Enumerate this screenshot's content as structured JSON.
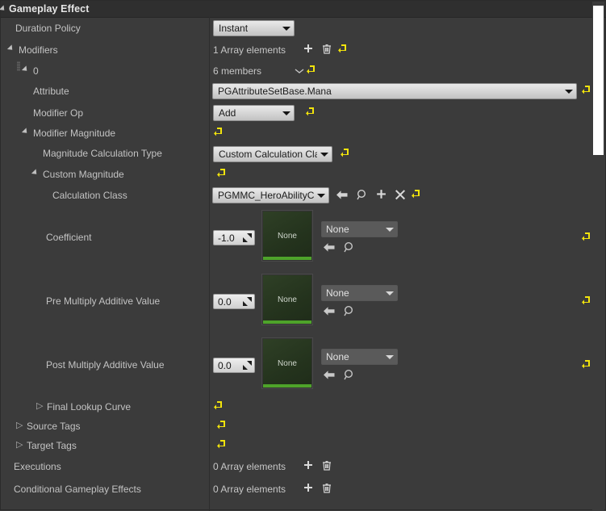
{
  "window": {
    "title": "Gameplay Effect",
    "expander": "expanded"
  },
  "colors": {
    "panel_bg": "#3b3b3b",
    "header_bg": "#2f2f2f",
    "reset_icon": "#f2e40c",
    "thumb_green": "#4ea32a",
    "text": "#c3c3c3"
  },
  "properties": {
    "duration_policy": {
      "label": "Duration Policy",
      "value": "Instant",
      "has_reset": false
    },
    "modifiers": {
      "label": "Modifiers",
      "value": "1 Array elements",
      "has_add": true,
      "has_delete": true,
      "has_reset": true
    },
    "modifier_index": {
      "label": "0",
      "value": "6 members",
      "has_reset": true
    },
    "attribute": {
      "label": "Attribute",
      "value": "PGAttributeSetBase.Mana",
      "has_reset": true
    },
    "modifier_op": {
      "label": "Modifier Op",
      "value": "Add",
      "has_reset": true
    },
    "modifier_magnitude": {
      "label": "Modifier Magnitude",
      "has_reset": true
    },
    "magnitude_calculation_type": {
      "label": "Magnitude Calculation Type",
      "value": "Custom Calculation Class",
      "has_reset": true
    },
    "custom_magnitude": {
      "label": "Custom Magnitude",
      "has_reset": true
    },
    "calculation_class": {
      "label": "Calculation Class",
      "value": "PGMMC_HeroAbilityCost",
      "toolbar": [
        "back-arrow-icon",
        "browse-icon",
        "new-asset-icon",
        "clear-icon",
        "reset-icon"
      ]
    },
    "coefficient": {
      "label": "Coefficient",
      "value": "-1.0",
      "thumbnail_label": "None",
      "curve_value": "None",
      "has_reset": true
    },
    "pre_multiply_additive_value": {
      "label": "Pre Multiply Additive Value",
      "value": "0.0",
      "thumbnail_label": "None",
      "curve_value": "None",
      "has_reset": true
    },
    "post_multiply_additive_value": {
      "label": "Post Multiply Additive Value",
      "value": "0.0",
      "thumbnail_label": "None",
      "curve_value": "None",
      "has_reset": true
    },
    "final_lookup_curve": {
      "label": "Final Lookup Curve",
      "has_reset": true
    },
    "source_tags": {
      "label": "Source Tags",
      "has_reset": true
    },
    "target_tags": {
      "label": "Target Tags",
      "has_reset": true
    },
    "executions": {
      "label": "Executions",
      "value": "0 Array elements",
      "has_add": true,
      "has_delete": true
    },
    "conditional_gameplay_effects": {
      "label": "Conditional Gameplay Effects",
      "value": "0 Array elements",
      "has_add": true,
      "has_delete": true
    }
  }
}
